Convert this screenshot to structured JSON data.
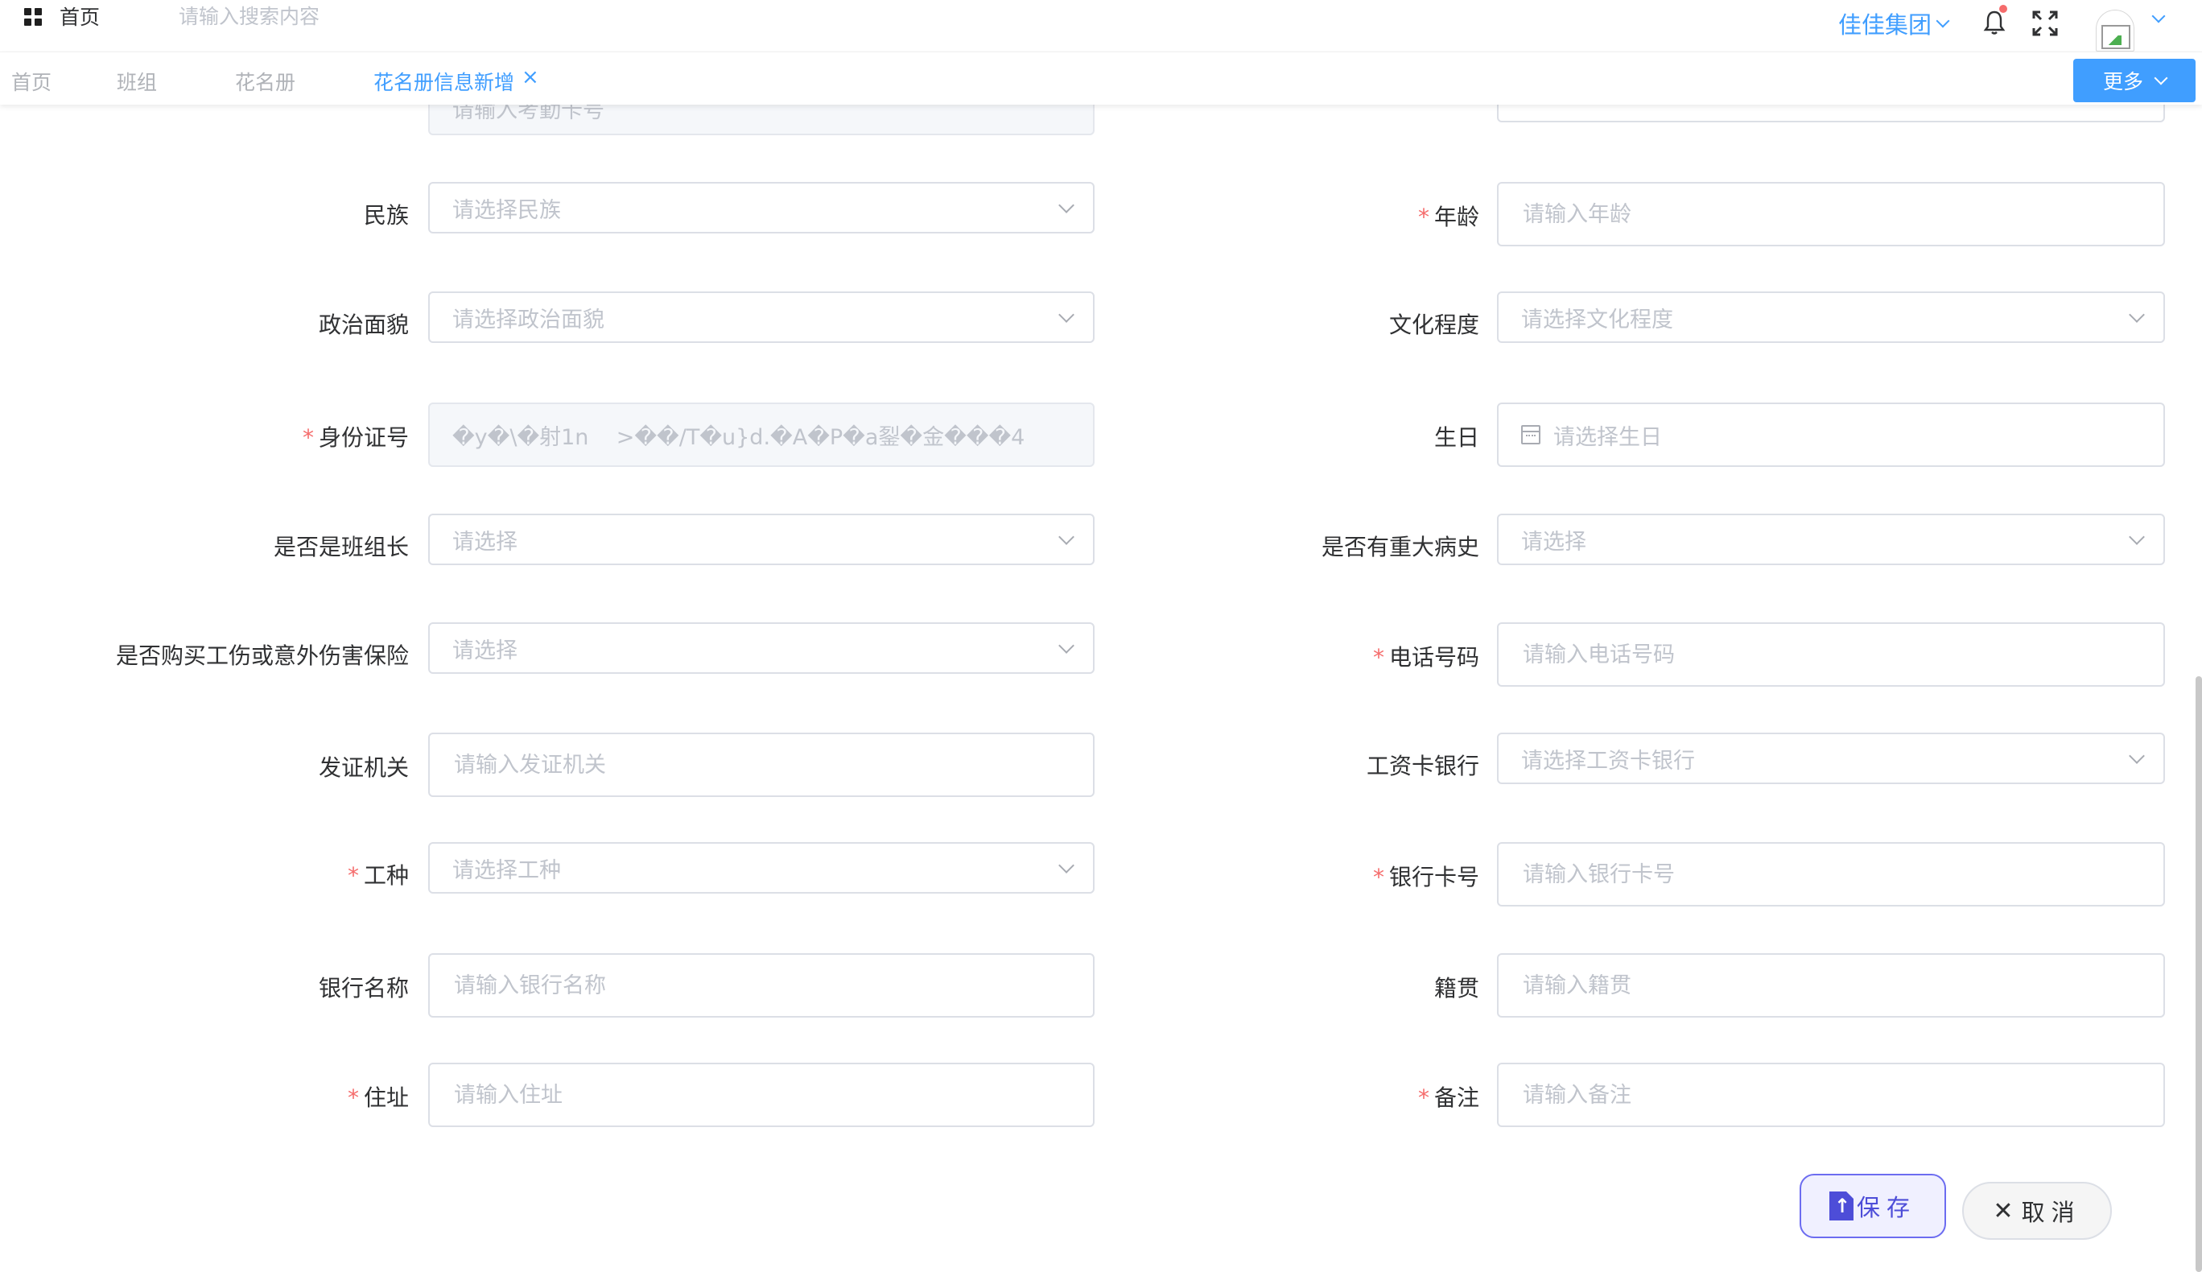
{
  "header": {
    "home_label": "首页",
    "search_placeholder": "请输入搜索内容",
    "company": "佳佳集团"
  },
  "tabs": {
    "items": [
      {
        "label": "首页"
      },
      {
        "label": "班组"
      },
      {
        "label": "花名册"
      },
      {
        "label": "花名册信息新增"
      }
    ],
    "active_index": 3,
    "close_symbol": "×",
    "more_label": "更多"
  },
  "form": {
    "partial_left_placeholder": "请输入考勤卡号",
    "partial_right_placeholder": "",
    "left": [
      {
        "label": "民族",
        "required": false,
        "type": "select",
        "placeholder": "请选择民族"
      },
      {
        "label": "政治面貌",
        "required": false,
        "type": "select",
        "placeholder": "请选择政治面貌"
      },
      {
        "label": "身份证号",
        "required": true,
        "type": "disabled",
        "value": "�y�\\�射1n    >��/T�u}d.�A�P�a銐�金���4"
      },
      {
        "label": "是否是班组长",
        "required": false,
        "type": "select",
        "placeholder": "请选择"
      },
      {
        "label": "是否购买工伤或意外伤害保险",
        "required": false,
        "type": "select",
        "placeholder": "请选择"
      },
      {
        "label": "发证机关",
        "required": false,
        "type": "input",
        "placeholder": "请输入发证机关"
      },
      {
        "label": "工种",
        "required": true,
        "type": "select",
        "placeholder": "请选择工种"
      },
      {
        "label": "银行名称",
        "required": false,
        "type": "input",
        "placeholder": "请输入银行名称"
      },
      {
        "label": "住址",
        "required": true,
        "type": "input",
        "placeholder": "请输入住址"
      }
    ],
    "right": [
      {
        "label": "年龄",
        "required": true,
        "type": "input",
        "placeholder": "请输入年龄"
      },
      {
        "label": "文化程度",
        "required": false,
        "type": "select",
        "placeholder": "请选择文化程度"
      },
      {
        "label": "生日",
        "required": false,
        "type": "date",
        "placeholder": "请选择生日"
      },
      {
        "label": "是否有重大病史",
        "required": false,
        "type": "select",
        "placeholder": "请选择"
      },
      {
        "label": "电话号码",
        "required": true,
        "type": "input",
        "placeholder": "请输入电话号码"
      },
      {
        "label": "工资卡银行",
        "required": false,
        "type": "select",
        "placeholder": "请选择工资卡银行"
      },
      {
        "label": "银行卡号",
        "required": true,
        "type": "input",
        "placeholder": "请输入银行卡号"
      },
      {
        "label": "籍贯",
        "required": false,
        "type": "input",
        "placeholder": "请输入籍贯"
      },
      {
        "label": "备注",
        "required": true,
        "type": "input",
        "placeholder": "请输入备注"
      }
    ],
    "required_mark": "*"
  },
  "actions": {
    "save_label": "保存",
    "cancel_label": "取消"
  },
  "colors": {
    "accent": "#409eff",
    "required": "#f56c6c",
    "save_border": "#6c6cf0"
  },
  "icons": {
    "apps": "grid-icon",
    "notification": "bell-icon",
    "fullscreen": "expand-icon",
    "upload": "upload-icon",
    "close": "close-icon",
    "calendar": "calendar-icon",
    "dropdown": "chevron-down-icon"
  }
}
